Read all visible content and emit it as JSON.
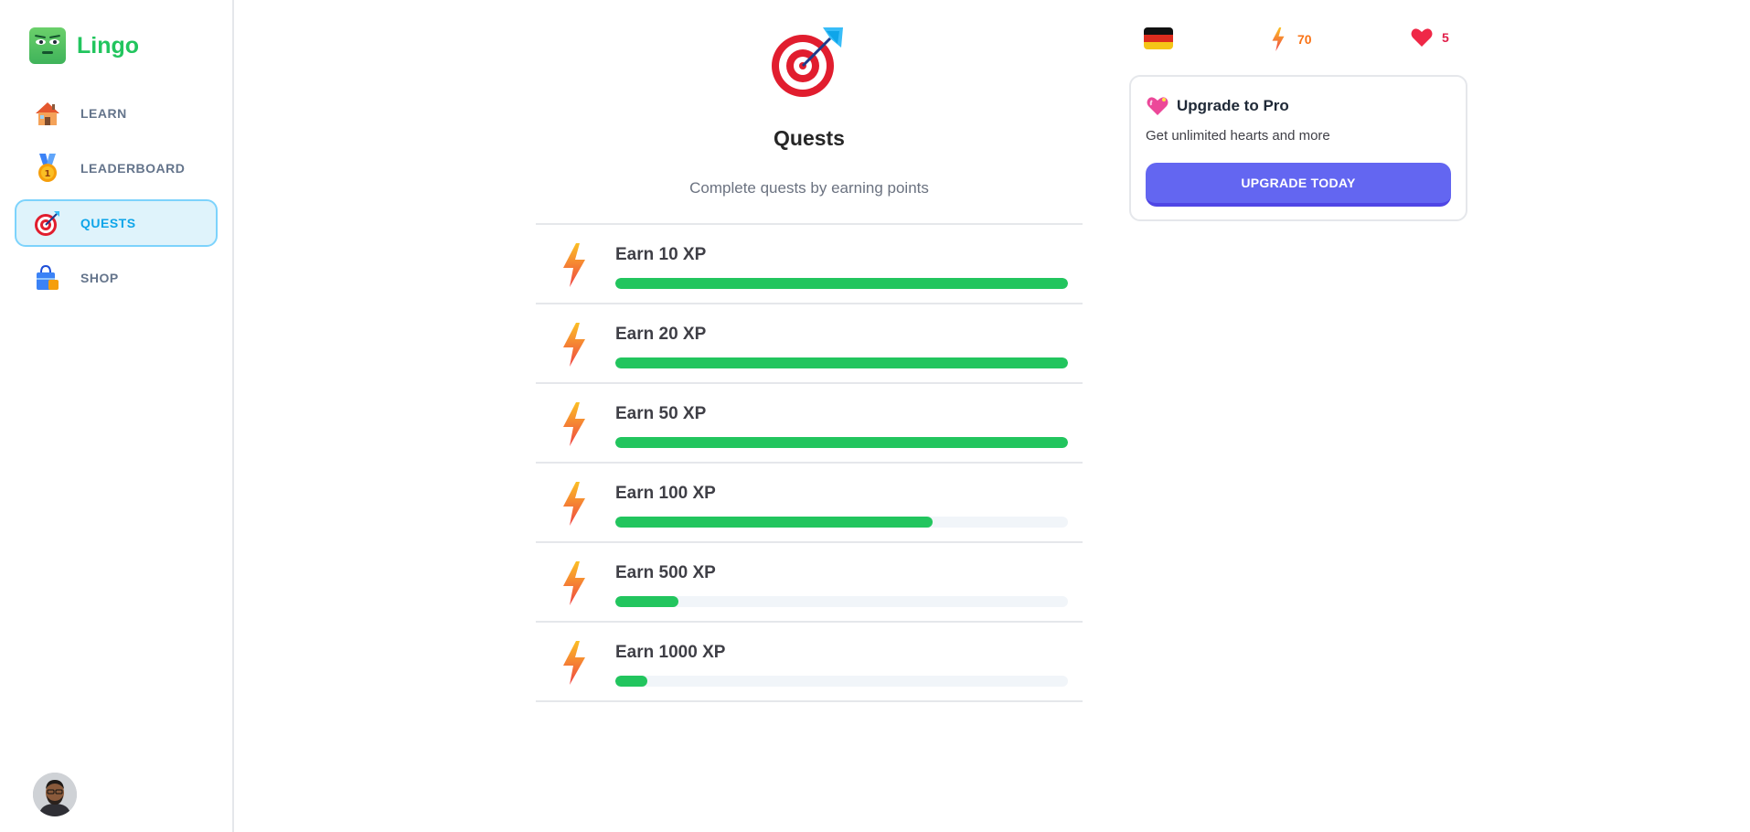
{
  "app": {
    "name": "Lingo"
  },
  "sidebar": {
    "items": [
      {
        "label": "LEARN",
        "icon": "house-icon",
        "active": false
      },
      {
        "label": "LEADERBOARD",
        "icon": "medal-icon",
        "active": false
      },
      {
        "label": "QUESTS",
        "icon": "target-icon",
        "active": true
      },
      {
        "label": "SHOP",
        "icon": "shopping-bag-icon",
        "active": false
      }
    ],
    "avatar": "user-avatar"
  },
  "main": {
    "title": "Quests",
    "subtitle": "Complete quests by earning points",
    "quests": [
      {
        "title": "Earn 10 XP",
        "progress": 1.0
      },
      {
        "title": "Earn 20 XP",
        "progress": 1.0
      },
      {
        "title": "Earn 50 XP",
        "progress": 1.0
      },
      {
        "title": "Earn 100 XP",
        "progress": 0.7
      },
      {
        "title": "Earn 500 XP",
        "progress": 0.14
      },
      {
        "title": "Earn 1000 XP",
        "progress": 0.07
      }
    ]
  },
  "stats": {
    "course_flag": "germany-flag-icon",
    "points": "70",
    "hearts": "5"
  },
  "upgrade": {
    "title": "Upgrade to Pro",
    "description": "Get unlimited hearts and more",
    "button_label": "UPGRADE TODAY"
  },
  "colors": {
    "accent_green": "#22c55e",
    "active_blue": "#0ea5e9",
    "upgrade_button": "#6366f1",
    "points_orange": "#f97316",
    "hearts_red": "#e11d48"
  }
}
